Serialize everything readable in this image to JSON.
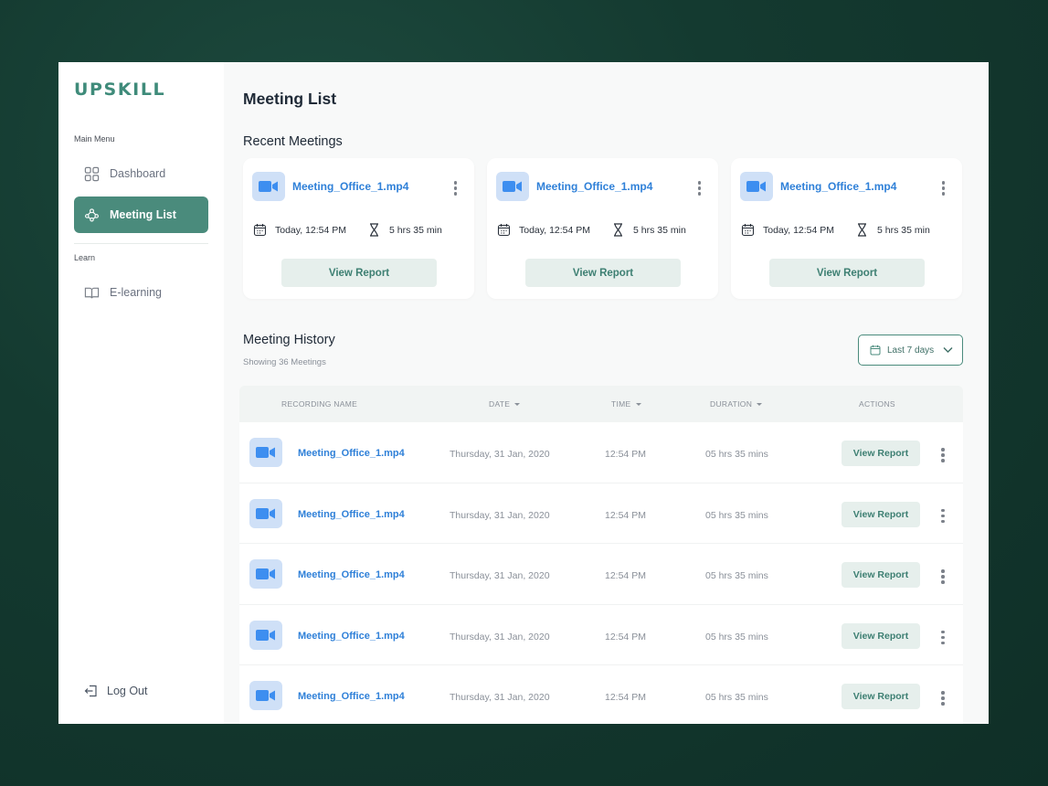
{
  "app": {
    "logo": "UPSKILL"
  },
  "sidebar": {
    "main_menu_label": "Main Menu",
    "learn_label": "Learn",
    "items": [
      {
        "label": "Dashboard",
        "icon": "grid-icon",
        "active": false
      },
      {
        "label": "Meeting List",
        "icon": "people-network-icon",
        "active": true
      },
      {
        "label": "E-learning",
        "icon": "book-icon",
        "active": false
      }
    ],
    "logout_label": "Log Out",
    "accent_color": "#4a8b7c"
  },
  "page": {
    "title": "Meeting List",
    "recent_title": "Recent Meetings",
    "history_title": "Meeting History",
    "history_subtitle": "Showing 36 Meetings",
    "date_filter": "Last 7 days"
  },
  "recent_meetings": [
    {
      "name": "Meeting_Office_1.mp4",
      "date": "Today, 12:54 PM",
      "duration": "5 hrs 35 min",
      "action": "View Report"
    },
    {
      "name": "Meeting_Office_1.mp4",
      "date": "Today, 12:54 PM",
      "duration": "5 hrs 35 min",
      "action": "View Report"
    },
    {
      "name": "Meeting_Office_1.mp4",
      "date": "Today, 12:54 PM",
      "duration": "5 hrs 35 min",
      "action": "View Report"
    }
  ],
  "table": {
    "columns": {
      "name": "RECORDING NAME",
      "date": "DATE",
      "time": "TIME",
      "duration": "DURATION",
      "actions": "ACTIONS"
    },
    "rows": [
      {
        "name": "Meeting_Office_1.mp4",
        "date": "Thursday, 31 Jan, 2020",
        "time": "12:54 PM",
        "duration": "05 hrs 35 mins",
        "action": "View Report"
      },
      {
        "name": "Meeting_Office_1.mp4",
        "date": "Thursday, 31 Jan, 2020",
        "time": "12:54 PM",
        "duration": "05 hrs 35 mins",
        "action": "View Report"
      },
      {
        "name": "Meeting_Office_1.mp4",
        "date": "Thursday, 31 Jan, 2020",
        "time": "12:54 PM",
        "duration": "05 hrs 35 mins",
        "action": "View Report"
      },
      {
        "name": "Meeting_Office_1.mp4",
        "date": "Thursday, 31 Jan, 2020",
        "time": "12:54 PM",
        "duration": "05 hrs 35 mins",
        "action": "View Report"
      },
      {
        "name": "Meeting_Office_1.mp4",
        "date": "Thursday, 31 Jan, 2020",
        "time": "12:54 PM",
        "duration": "05 hrs 35 mins",
        "action": "View Report"
      }
    ]
  },
  "colors": {
    "link_blue": "#2f80d8",
    "thumb_bg": "#cfe0f7",
    "button_bg": "#e6efec",
    "button_text": "#3d7f72"
  }
}
